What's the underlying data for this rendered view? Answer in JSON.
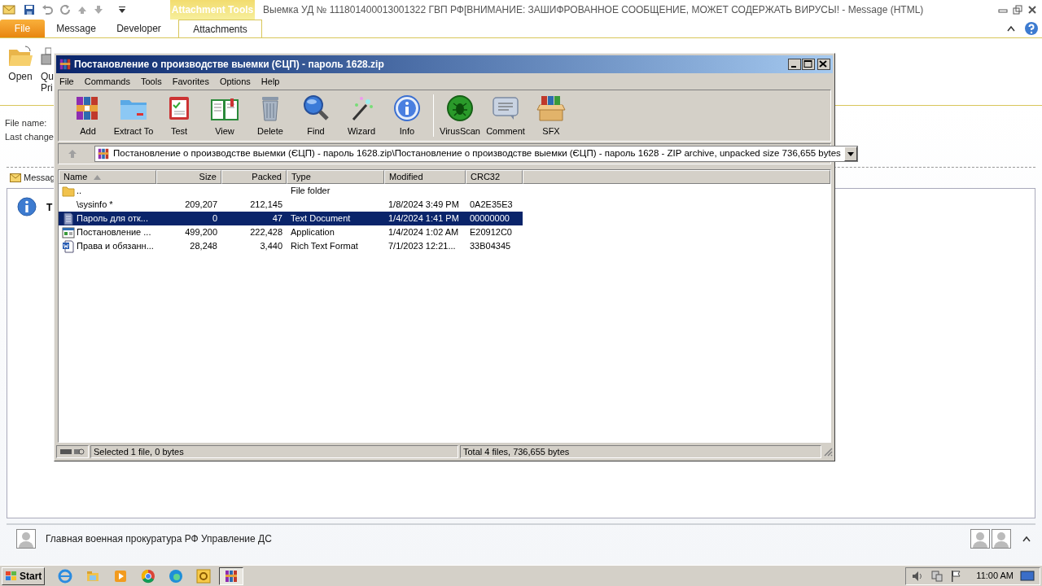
{
  "outlook": {
    "title": "Выемка УД № 111801400013001322  ГВП РФ[ВНИМАНИЕ: ЗАШИФРОВАННОЕ СООБЩЕНИЕ, МОЖЕТ СОДЕРЖАТЬ ВИРУСЫ! - Message (HTML)",
    "context_tab": "Attachment Tools",
    "tabs": [
      {
        "label": "File",
        "kind": "file",
        "selected": false
      },
      {
        "label": "Message",
        "kind": "plain",
        "selected": false
      },
      {
        "label": "Developer",
        "kind": "plain",
        "selected": false
      },
      {
        "label": "Attachments",
        "kind": "plain",
        "selected": true
      }
    ],
    "ribbon": [
      {
        "kind": "open",
        "lines": [
          "Open"
        ]
      },
      {
        "kind": "print",
        "lines": [
          "Qu",
          "Pri"
        ]
      }
    ],
    "fields": [
      "File name:",
      "Last change"
    ],
    "message_tab": "Messag",
    "info_text": "T",
    "people": {
      "name": "Главная военная прокуратура РФ Управление ДС"
    }
  },
  "winrar": {
    "title": "Постановление о производстве выемки (ЄЦП) - пароль 1628.zip",
    "menu": [
      "File",
      "Commands",
      "Tools",
      "Favorites",
      "Options",
      "Help"
    ],
    "toolbar": [
      {
        "label": "Add",
        "kind": "add"
      },
      {
        "label": "Extract To",
        "kind": "extract"
      },
      {
        "label": "Test",
        "kind": "test"
      },
      {
        "label": "View",
        "kind": "view"
      },
      {
        "label": "Delete",
        "kind": "delete"
      },
      {
        "label": "Find",
        "kind": "find"
      },
      {
        "label": "Wizard",
        "kind": "wizard"
      },
      {
        "label": "Info",
        "kind": "info"
      },
      {
        "label": "VirusScan",
        "kind": "virus"
      },
      {
        "label": "Comment",
        "kind": "comment"
      },
      {
        "label": "SFX",
        "kind": "sfx"
      }
    ],
    "address": "Постановление о производстве выемки (ЄЦП) - пароль 1628.zip\\Постановление о производстве выемки (ЄЦП) - пароль 1628 - ZIP archive, unpacked size 736,655 bytes",
    "columns": [
      "Name",
      "Size",
      "Packed",
      "Type",
      "Modified",
      "CRC32"
    ],
    "rows": [
      {
        "kind": "folder",
        "selected": false,
        "cells": [
          "..",
          "",
          "",
          "File folder",
          "",
          ""
        ]
      },
      {
        "kind": "none",
        "selected": false,
        "cells": [
          "\\sysinfo *",
          "209,207",
          "212,145",
          "",
          "1/8/2024 3:49 PM",
          "0A2E35E3"
        ]
      },
      {
        "kind": "text",
        "selected": true,
        "cells": [
          "Пароль для отк...",
          "0",
          "47",
          "Text Document",
          "1/4/2024 1:41 PM",
          "00000000"
        ]
      },
      {
        "kind": "app",
        "selected": false,
        "cells": [
          "Постановление ...",
          "499,200",
          "222,428",
          "Application",
          "1/4/2024 1:02 AM",
          "E20912C0"
        ]
      },
      {
        "kind": "doc",
        "selected": false,
        "cells": [
          "Права и обязанн...",
          "28,248",
          "3,440",
          "Rich Text Format",
          "7/1/2023 12:21...",
          "33B04345"
        ]
      }
    ],
    "status": [
      "Selected 1 file, 0 bytes",
      "Total 4 files, 736,655 bytes"
    ]
  },
  "taskbar": {
    "start": "Start",
    "clock": "11:00 AM",
    "apps": [
      {
        "kind": "ie",
        "selected": false
      },
      {
        "kind": "explorer",
        "selected": false
      },
      {
        "kind": "media",
        "selected": false
      },
      {
        "kind": "chrome",
        "selected": false
      },
      {
        "kind": "edge",
        "selected": false
      },
      {
        "kind": "outlook",
        "selected": false
      },
      {
        "kind": "winrar",
        "selected": true
      }
    ]
  }
}
